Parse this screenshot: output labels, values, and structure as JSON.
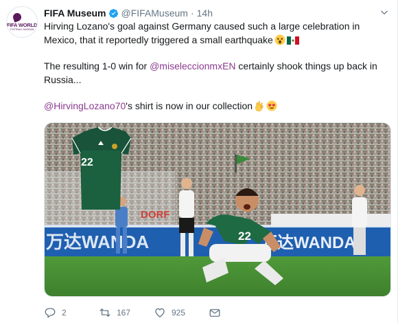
{
  "account": {
    "name": "FIFA Museum",
    "handle": "@FIFAMuseum",
    "separator": "·",
    "time": "14h",
    "avatar_text_line1": "FIFA WORLD",
    "avatar_text_line2": "FOOTBALL MUSEUM"
  },
  "tweet": {
    "para1": "Hirving Lozano's goal against Germany caused such a large celebration in Mexico, that it reportedly triggered a small earthquake",
    "para2_pre": "The resulting 1-0 win for ",
    "para2_mention": "@miseleccionmxEN",
    "para2_post": " certainly shook things up back in Russia...",
    "para3_mention": "@HirvingLozano70",
    "para3_post": "'s shirt is now in our collection"
  },
  "media": {
    "shirt_number": "22",
    "player_number": "22",
    "board_text": "万达WANDA",
    "board_text2": "万达WANDA",
    "board_text_left": "DORF"
  },
  "actions": {
    "replies": "2",
    "retweets": "167",
    "likes": "925"
  },
  "colors": {
    "mention": "#8b3a8f",
    "verified": "#1da1f2",
    "text": "#14171a",
    "secondary": "#657786"
  }
}
